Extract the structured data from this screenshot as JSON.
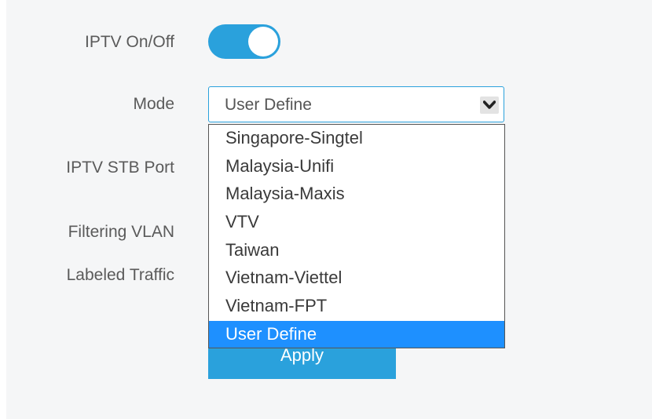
{
  "form": {
    "iptv_label": "IPTV On/Off",
    "iptv_enabled": true,
    "mode_label": "Mode",
    "stb_port_label": "IPTV STB Port",
    "filtering_vlan_label": "Filtering VLAN",
    "labeled_traffic_label": "Labeled Traffic",
    "mode_value": "User Define",
    "apply_label": "Apply"
  },
  "mode_options": [
    "Singapore-Singtel",
    "Malaysia-Unifi",
    "Malaysia-Maxis",
    "VTV",
    "Taiwan",
    "Vietnam-Viettel",
    "Vietnam-FPT",
    "User Define"
  ],
  "selected_option": "User Define",
  "colors": {
    "accent": "#2aa1dc",
    "selected_option_bg": "#1e90ff",
    "panel_bg": "#f5f6f7",
    "label_text": "#5a5a5a"
  },
  "icons": {
    "dropdown_arrow": "chevron-down-icon"
  }
}
